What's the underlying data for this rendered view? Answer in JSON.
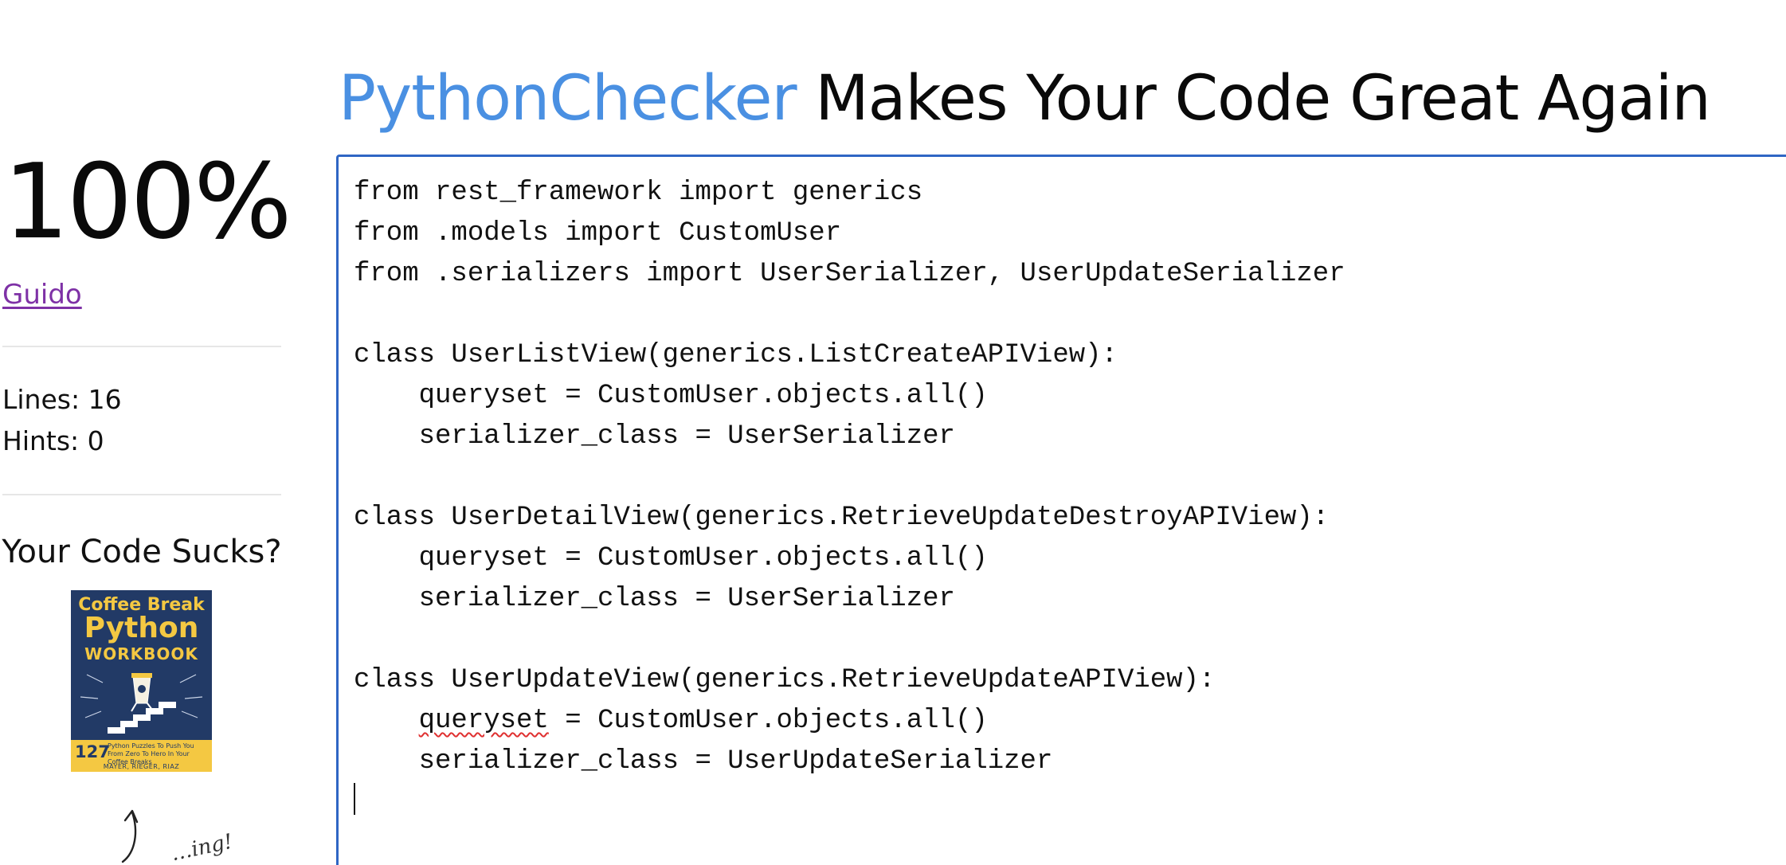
{
  "header": {
    "brand": "PythonChecker",
    "tagline": " Makes Your Code Great Again"
  },
  "sidebar": {
    "score": "100%",
    "user_link": "Guido",
    "lines_stat": "Lines: 16",
    "hints_stat": "Hints: 0",
    "promo_heading": "Your Code Sucks?",
    "book": {
      "title_line1": "Coffee Break",
      "title_line2": "Python",
      "title_line3": "WORKBOOK",
      "puzzle_count": "127",
      "subtitle": "Python Puzzles To Push You From Zero To Hero In Your Coffee Breaks",
      "authors": "MAYER, RIEGER, RIAZ"
    },
    "handwriting": "…ing!"
  },
  "editor": {
    "lines": [
      "from rest_framework import generics",
      "from .models import CustomUser",
      "from .serializers import UserSerializer, UserUpdateSerializer",
      "",
      "class UserListView(generics.ListCreateAPIView):",
      "    queryset = CustomUser.objects.all()",
      "    serializer_class = UserSerializer",
      "",
      "class UserDetailView(generics.RetrieveUpdateDestroyAPIView):",
      "    queryset = CustomUser.objects.all()",
      "    serializer_class = UserSerializer",
      "",
      "class UserUpdateView(generics.RetrieveUpdateAPIView):",
      "    ",
      "    serializer_class = UserUpdateSerializer",
      ""
    ],
    "misspelled_word": "queryset",
    "misspelled_rest": " = CustomUser.objects.all()"
  },
  "colors": {
    "brand": "#4a90e2",
    "link": "#7e31a6",
    "editor_border": "#2f66c4",
    "spellcheck": "#e03030",
    "book_navy": "#223a66",
    "book_yellow": "#f4c842"
  }
}
